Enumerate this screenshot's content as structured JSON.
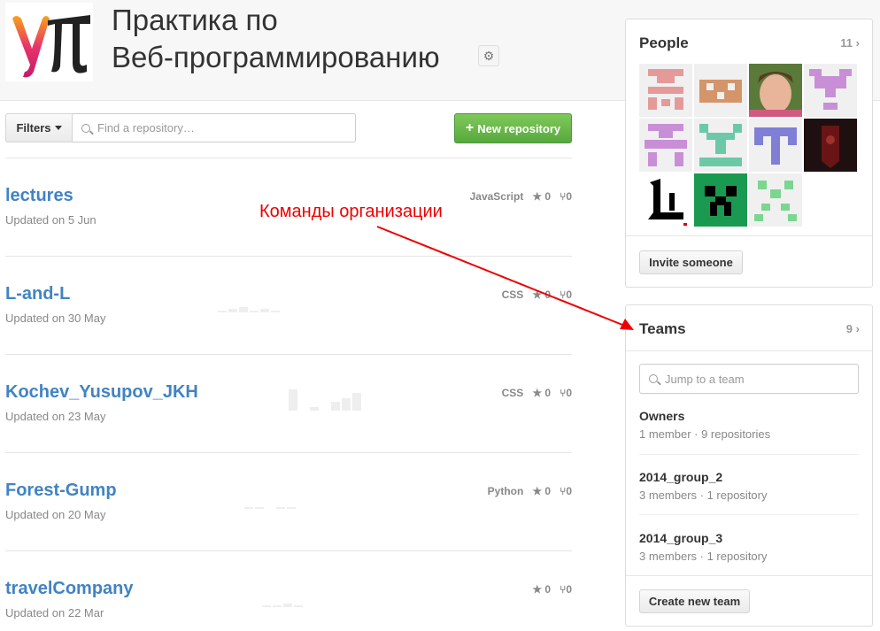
{
  "org": {
    "title_line1": "Практика по",
    "title_line2": "Веб-программированию",
    "logo_text": "УП",
    "settings_icon": "gear-icon"
  },
  "toolbar": {
    "filters_label": "Filters",
    "search_placeholder": "Find a repository…",
    "new_repo_label": "New repository",
    "new_repo_plus": "+"
  },
  "repos": [
    {
      "name": "lectures",
      "updated": "Updated on 5 Jun",
      "language": "JavaScript",
      "stars": "0",
      "forks": "0"
    },
    {
      "name": "L-and-L",
      "updated": "Updated on 30 May",
      "language": "CSS",
      "stars": "0",
      "forks": "0"
    },
    {
      "name": "Kochev_Yusupov_JKH",
      "updated": "Updated on 23 May",
      "language": "CSS",
      "stars": "0",
      "forks": "0"
    },
    {
      "name": "Forest-Gump",
      "updated": "Updated on 20 May",
      "language": "Python",
      "stars": "0",
      "forks": "0"
    },
    {
      "name": "travelCompany",
      "updated": "Updated on 22 Mar",
      "language": "",
      "stars": "0",
      "forks": "0"
    }
  ],
  "people": {
    "title": "People",
    "count": "11",
    "invite_label": "Invite someone",
    "avatar_colors": [
      "#e59a9a",
      "#d4956b",
      "#c77c5a",
      "#c98fd6",
      "#c98fd6",
      "#6cc9a8",
      "#7f7fd6",
      "#3a1a1a",
      "#222222",
      "#1a9a50",
      "#7bd68f"
    ]
  },
  "teams": {
    "title": "Teams",
    "count": "9",
    "search_placeholder": "Jump to a team",
    "create_label": "Create new team",
    "items": [
      {
        "name": "Owners",
        "info": "1 member · 9 repositories"
      },
      {
        "name": "2014_group_2",
        "info": "3 members · 1 repository"
      },
      {
        "name": "2014_group_3",
        "info": "3 members · 1 repository"
      }
    ]
  },
  "annotation": {
    "text": "Команды организации",
    "color": "#e00000"
  }
}
